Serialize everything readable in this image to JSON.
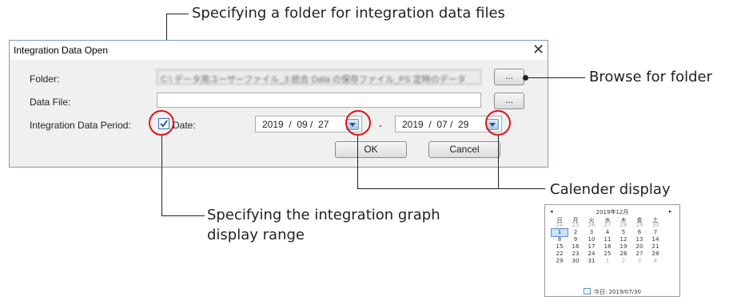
{
  "callouts": {
    "folder_spec": "Specifying a folder for integration data files",
    "browse": "Browse for folder",
    "calendar": "Calender display",
    "range_line1": "Specifying the integration graph",
    "range_line2": "display range"
  },
  "dialog": {
    "title": "Integration Data Open",
    "close_glyph": "✕",
    "folder_label": "Folder:",
    "folder_value": "C:\\ データ用ユーザーファイル_3 統合 Data の保存ファイル_PS 定時のデータ",
    "data_file_label": "Data File:",
    "data_file_value": "",
    "browse_label": "...",
    "period_label": "Integration Data Period:",
    "date_checkbox_checked": true,
    "date_label": "Date:",
    "start_date": "2019  /  09 /  27",
    "separator": "-",
    "end_date": "2019  /  07 /  29",
    "ok_label": "OK",
    "cancel_label": "Cancel"
  },
  "calendar": {
    "prev": "◂",
    "next": "▸",
    "header": "2019年12月",
    "weekdays": [
      "日",
      "月",
      "火",
      "水",
      "木",
      "金",
      "土"
    ],
    "weeks": [
      [
        "24",
        "25",
        "26",
        "27",
        "28",
        "29",
        "30"
      ],
      [
        "1",
        "2",
        "3",
        "4",
        "5",
        "6",
        "7"
      ],
      [
        "8",
        "9",
        "10",
        "11",
        "12",
        "13",
        "14"
      ],
      [
        "15",
        "16",
        "17",
        "18",
        "19",
        "20",
        "21"
      ],
      [
        "22",
        "23",
        "24",
        "25",
        "26",
        "27",
        "28"
      ],
      [
        "29",
        "30",
        "31",
        "1",
        "2",
        "3",
        "4"
      ]
    ],
    "today": "今日: 2019/07/30"
  },
  "colors": {
    "highlight": "#d9151c",
    "dialog_border": "#7a9cc7"
  }
}
